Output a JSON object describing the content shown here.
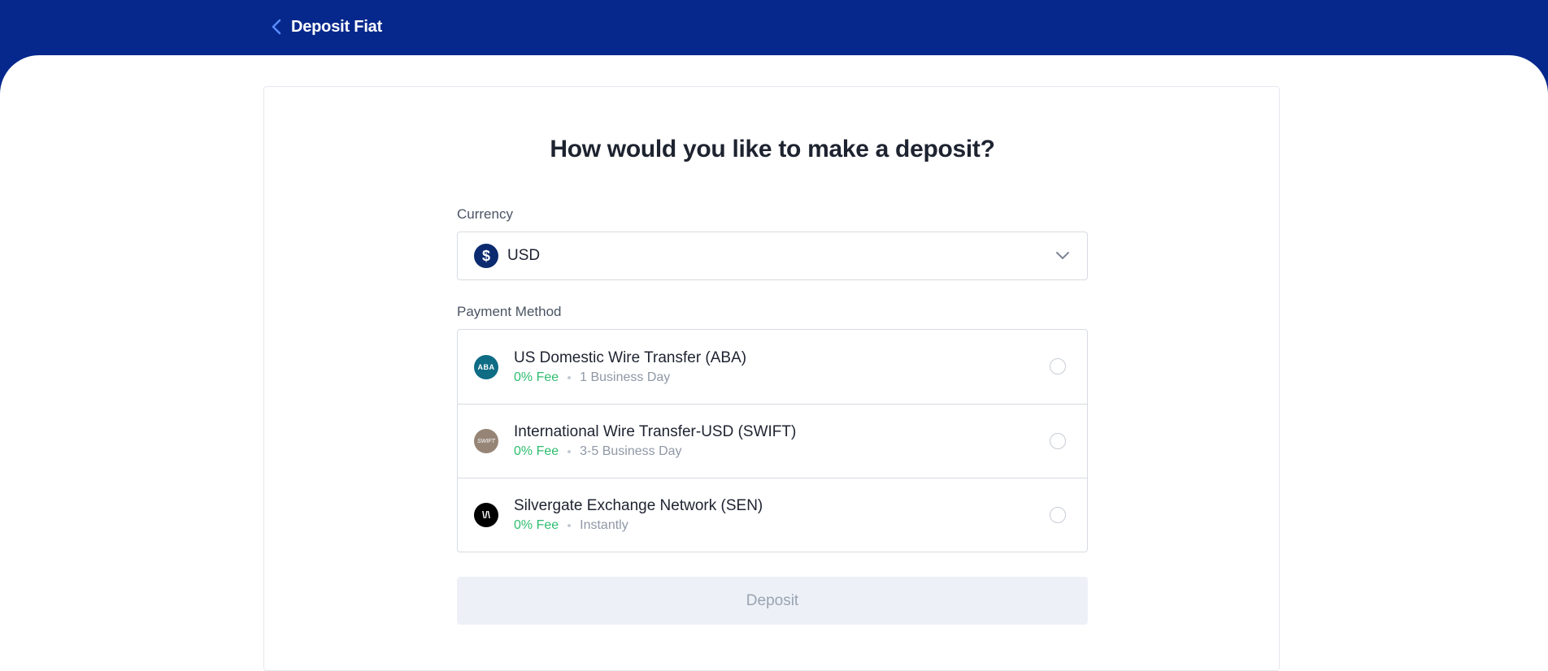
{
  "header": {
    "back_icon": "chevron-left-icon",
    "title": "Deposit Fiat",
    "background": "#06288c"
  },
  "main": {
    "question": "How would you like to make a deposit?",
    "currency": {
      "label": "Currency",
      "icon": "dollar-icon",
      "icon_glyph": "$",
      "selected": "USD"
    },
    "payment_method": {
      "label": "Payment Method",
      "options": [
        {
          "name": "US Domestic Wire Transfer (ABA)",
          "icon_text": "ABA",
          "fee": "0% Fee",
          "time": "1 Business Day",
          "selected": false
        },
        {
          "name": "International Wire Transfer-USD (SWIFT)",
          "icon_text": "SWIFT",
          "fee": "0% Fee",
          "time": "3-5 Business Day",
          "selected": false
        },
        {
          "name": "Silvergate Exchange Network (SEN)",
          "icon_text": "\\/\\",
          "fee": "0% Fee",
          "time": "Instantly",
          "selected": false
        }
      ]
    },
    "deposit_button": "Deposit"
  },
  "colors": {
    "accent": "#06288c",
    "fee_green": "#2ebd6f",
    "muted_text": "#8f98a6",
    "disabled_button_bg": "#edf1f7"
  }
}
